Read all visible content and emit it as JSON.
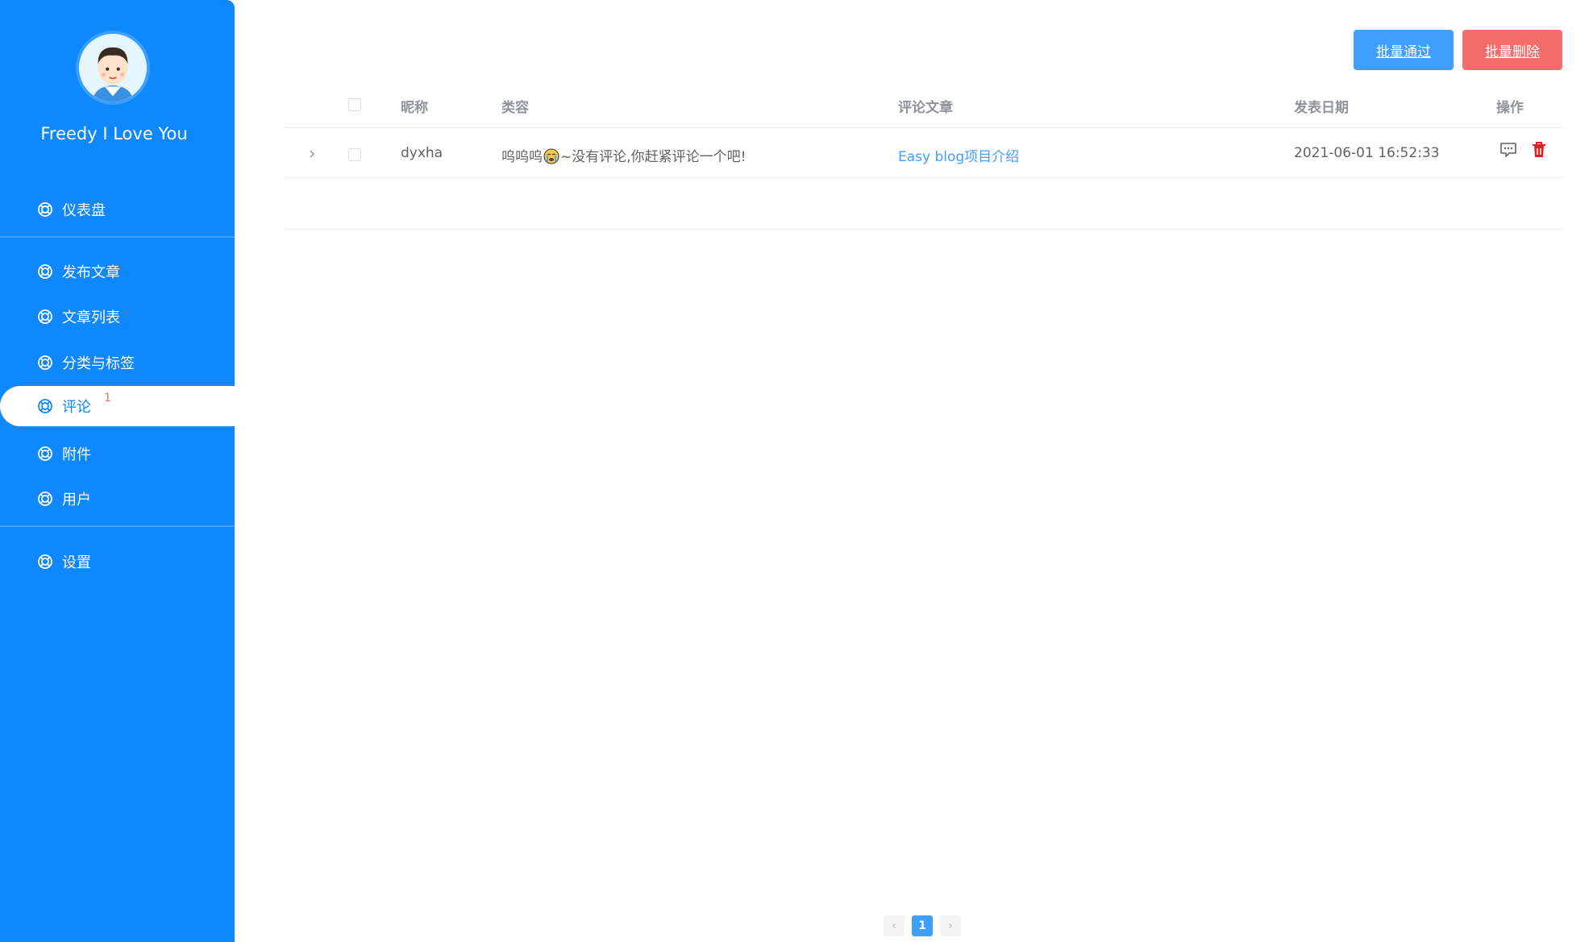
{
  "sidebar": {
    "user_name": "Freedy I Love You",
    "items": [
      {
        "label": "仪表盘"
      },
      {
        "label": "发布文章"
      },
      {
        "label": "文章列表"
      },
      {
        "label": "分类与标签"
      },
      {
        "label": "评论",
        "badge": "1",
        "active": true
      },
      {
        "label": "附件"
      },
      {
        "label": "用户"
      },
      {
        "label": "设置"
      }
    ]
  },
  "toolbar": {
    "approve_label": "批量通过",
    "delete_label": "批量删除"
  },
  "table": {
    "columns": [
      "昵称",
      "类容",
      "评论文章",
      "发表日期",
      "操作"
    ],
    "rows": [
      {
        "nickname": "dyxha",
        "content_prefix": "呜呜呜",
        "content_suffix": "~没有评论,你赶紧评论一个吧!",
        "article": "Easy blog项目介绍",
        "date": "2021-06-01 16:52:33"
      }
    ]
  },
  "pagination": {
    "prev": "‹",
    "current": "1",
    "next": "›"
  },
  "colors": {
    "sidebar": "#0f87ff",
    "primary": "#409eff",
    "danger": "#f56c6c"
  }
}
